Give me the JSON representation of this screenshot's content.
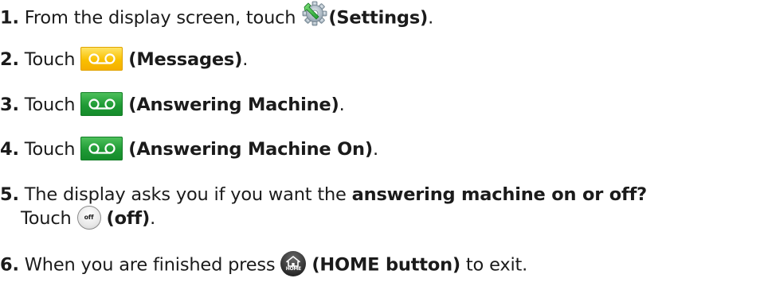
{
  "steps": [
    {
      "num": "1.",
      "before": " From the display screen, touch ",
      "icon": "settings-icon",
      "label": "(Settings)",
      "after": "."
    },
    {
      "num": "2.",
      "before": " Touch ",
      "icon": "messages-icon",
      "label": "(Messages)",
      "after": "."
    },
    {
      "num": "3.",
      "before": " Touch ",
      "icon": "answering-machine-icon",
      "label": "(Answering Machine)",
      "after": "."
    },
    {
      "num": "4.",
      "before": " Touch ",
      "icon": "answering-machine-on-icon",
      "label": "(Answering Machine On)",
      "after": "."
    },
    {
      "num": "5.",
      "before": " The display asks you if you want the ",
      "bold": "answering machine on or off?",
      "line2_before": "Touch ",
      "icon": "off-button-icon",
      "icon_text": "off",
      "label": "(off)",
      "after": "."
    },
    {
      "num": "6.",
      "before": " When you are finished press ",
      "icon": "home-button-icon",
      "icon_text": "HOME",
      "label": "(HOME button)",
      "after": " to exit."
    }
  ],
  "colors": {
    "text": "#1b1b1b",
    "messages_yellow": "#f9c000",
    "answering_green": "#1f9a35",
    "home_dark": "#2c2c2c"
  }
}
